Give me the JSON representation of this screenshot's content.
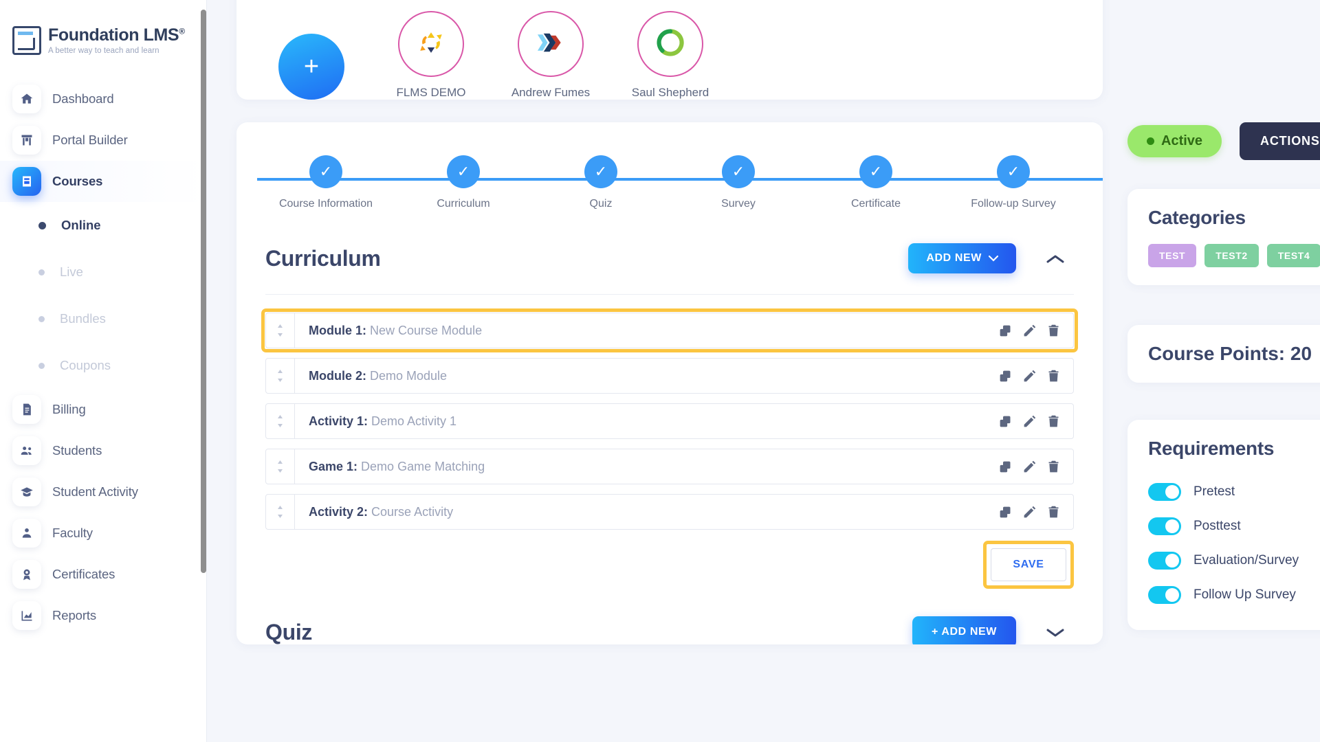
{
  "brand": {
    "title": "Foundation LMS",
    "registered": "®",
    "tagline": "A better way to teach and learn"
  },
  "sidebar": {
    "items": [
      {
        "label": "Dashboard",
        "icon": "home-icon",
        "active": false
      },
      {
        "label": "Portal Builder",
        "icon": "portal-icon",
        "active": false
      },
      {
        "label": "Courses",
        "icon": "book-icon",
        "active": true
      }
    ],
    "subitems": [
      {
        "label": "Online",
        "active": true
      },
      {
        "label": "Live",
        "active": false
      },
      {
        "label": "Bundles",
        "active": false
      },
      {
        "label": "Coupons",
        "active": false
      }
    ],
    "items_bottom": [
      {
        "label": "Billing",
        "icon": "invoice-icon"
      },
      {
        "label": "Students",
        "icon": "users-icon"
      },
      {
        "label": "Student Activity",
        "icon": "graduation-cap-icon"
      },
      {
        "label": "Faculty",
        "icon": "person-icon"
      },
      {
        "label": "Certificates",
        "icon": "award-icon"
      },
      {
        "label": "Reports",
        "icon": "chart-icon"
      }
    ]
  },
  "stories": {
    "add_label": "+",
    "items": [
      {
        "name": "FLMS DEMO",
        "icon": "recycle-logo-icon"
      },
      {
        "name": "Andrew Fumes",
        "icon": "chevron-logo-icon"
      },
      {
        "name": "Saul Shepherd",
        "icon": "ring-logo-icon"
      }
    ]
  },
  "stepper": {
    "check": "✓",
    "steps": [
      {
        "label": "Course Information",
        "complete": true
      },
      {
        "label": "Curriculum",
        "complete": true
      },
      {
        "label": "Quiz",
        "complete": true
      },
      {
        "label": "Survey",
        "complete": true
      },
      {
        "label": "Certificate",
        "complete": true
      },
      {
        "label": "Follow-up Survey",
        "complete": true
      }
    ]
  },
  "curriculum": {
    "title": "Curriculum",
    "add_new_label": "ADD NEW",
    "add_new_chevron": "⌄",
    "collapse_icon": "^",
    "save_label": "SAVE",
    "rows": [
      {
        "prefix": "Module 1:",
        "name": " New Course Module",
        "highlighted": true
      },
      {
        "prefix": "Module 2:",
        "name": " Demo Module",
        "highlighted": false
      },
      {
        "prefix": "Activity 1:",
        "name": " Demo Activity 1",
        "highlighted": false
      },
      {
        "prefix": "Game 1:",
        "name": " Demo Game Matching",
        "highlighted": false
      },
      {
        "prefix": "Activity 2:",
        "name": " Course Activity",
        "highlighted": false
      }
    ],
    "row_actions": [
      "duplicate-icon",
      "edit-icon",
      "delete-icon"
    ]
  },
  "quiz": {
    "title": "Quiz",
    "add_new_label": "+ ADD NEW",
    "collapse_icon": "⌄"
  },
  "right_panel": {
    "status_label": "Active",
    "actions_label": "ACTIONS",
    "categories_title": "Categories",
    "tags": [
      {
        "label": "TEST",
        "color": "#c9a4e8"
      },
      {
        "label": "TEST2",
        "color": "#7ed0a0"
      },
      {
        "label": "TEST4",
        "color": "#7ed0a0"
      }
    ],
    "course_points_title": "Course Points: 20",
    "requirements_title": "Requirements",
    "requirements": [
      {
        "label": "Pretest",
        "on": true
      },
      {
        "label": "Posttest",
        "on": true
      },
      {
        "label": "Evaluation/Survey",
        "on": true
      },
      {
        "label": "Follow Up Survey",
        "on": true
      }
    ]
  },
  "colors": {
    "accent_blue": "#2356ee",
    "highlight_yellow": "#fbc541",
    "active_green": "#9ae86b",
    "toggle_cyan": "#13c7f0",
    "story_ring": "#d957a8"
  }
}
